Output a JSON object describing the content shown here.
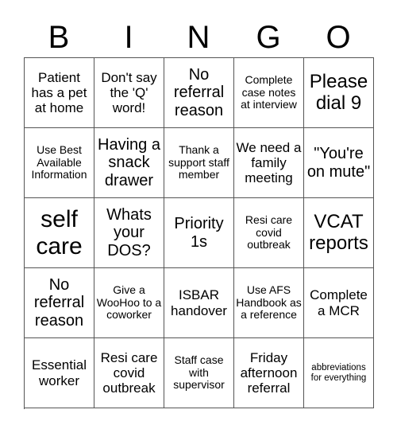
{
  "header": {
    "letters": [
      "B",
      "I",
      "N",
      "G",
      "O"
    ]
  },
  "cells": [
    {
      "text": "Patient has a pet at home",
      "size": "md"
    },
    {
      "text": "Don't say the 'Q' word!",
      "size": "md"
    },
    {
      "text": "No referral reason",
      "size": "lg"
    },
    {
      "text": "Complete case notes at interview",
      "size": "sm"
    },
    {
      "text": "Please dial 9",
      "size": "xl"
    },
    {
      "text": "Use Best Available Information",
      "size": "sm"
    },
    {
      "text": "Having a snack drawer",
      "size": "lg"
    },
    {
      "text": "Thank a support staff member",
      "size": "sm"
    },
    {
      "text": "We need a family meeting",
      "size": "md"
    },
    {
      "text": "\"You're on mute\"",
      "size": "lg"
    },
    {
      "text": "self care",
      "size": "xxl"
    },
    {
      "text": "Whats your DOS?",
      "size": "lg"
    },
    {
      "text": "Priority 1s",
      "size": "lg"
    },
    {
      "text": "Resi care covid outbreak",
      "size": "sm"
    },
    {
      "text": "VCAT reports",
      "size": "xl"
    },
    {
      "text": "No referral reason",
      "size": "lg"
    },
    {
      "text": "Give a WooHoo to a coworker",
      "size": "sm"
    },
    {
      "text": "ISBAR handover",
      "size": "md"
    },
    {
      "text": "Use AFS Handbook as a reference",
      "size": "sm"
    },
    {
      "text": "Complete a MCR",
      "size": "md"
    },
    {
      "text": "Essential worker",
      "size": "md"
    },
    {
      "text": "Resi care covid outbreak",
      "size": "md"
    },
    {
      "text": "Staff case with supervisor",
      "size": "sm"
    },
    {
      "text": "Friday afternoon referral",
      "size": "md"
    },
    {
      "text": "abbreviations for everything",
      "size": "xs"
    }
  ]
}
